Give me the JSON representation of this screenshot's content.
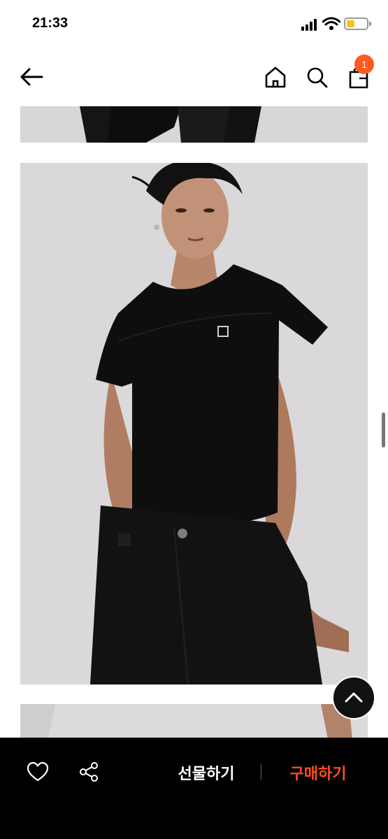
{
  "status_bar": {
    "time": "21:33"
  },
  "nav": {
    "cart_count": "1"
  },
  "bottom_bar": {
    "gift_label": "선물하기",
    "buy_label": "구매하기"
  },
  "colors": {
    "accent": "#ff4d1a",
    "badge": "#ff5a1f",
    "bar_bg": "#000000"
  },
  "icons": [
    "back-arrow-icon",
    "home-icon",
    "search-icon",
    "cart-icon",
    "heart-icon",
    "share-icon",
    "chevron-up-icon"
  ]
}
